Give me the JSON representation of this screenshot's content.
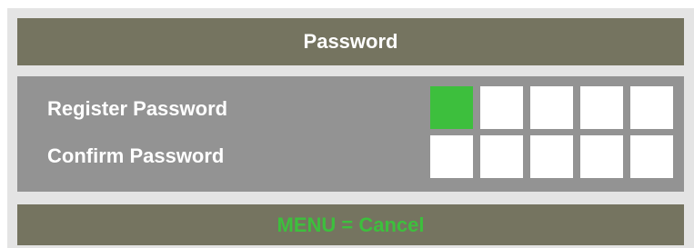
{
  "header": {
    "title": "Password"
  },
  "rows": [
    {
      "label": "Register Password",
      "digits": 5,
      "filled": 1
    },
    {
      "label": "Confirm Password",
      "digits": 5,
      "filled": 0
    }
  ],
  "footer": {
    "hint": "MENU = Cancel"
  },
  "colors": {
    "bar": "#757460",
    "panel": "#939393",
    "frame": "#e4e4e4",
    "active_box": "#3dbf3d",
    "empty_box": "#ffffff",
    "hint_text": "#3dbf3d"
  }
}
